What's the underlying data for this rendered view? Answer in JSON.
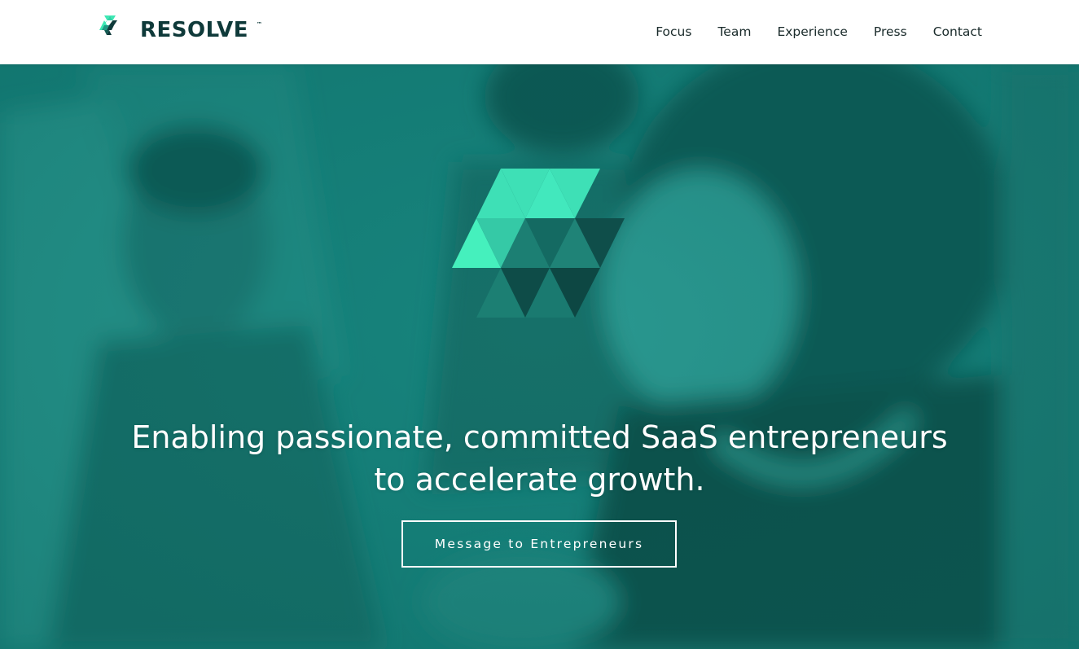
{
  "brand": {
    "name": "RESOLVE",
    "trademark": "™",
    "logo_icon": "resolve-triangles-logo-icon",
    "colors": {
      "dark": "#0f3a3a",
      "mint": "#3de8b4",
      "teal": "#2bb79a",
      "hero_teal": "#16807a"
    }
  },
  "nav": {
    "items": [
      {
        "label": "Focus"
      },
      {
        "label": "Team"
      },
      {
        "label": "Experience"
      },
      {
        "label": "Press"
      },
      {
        "label": "Contact"
      }
    ]
  },
  "hero": {
    "background_image": "team-at-whiteboard-photo",
    "headline_line1": "Enabling passionate, committed SaaS entrepreneurs",
    "headline_line2": "to accelerate growth.",
    "cta_label": "Message to Entrepreneurs"
  }
}
